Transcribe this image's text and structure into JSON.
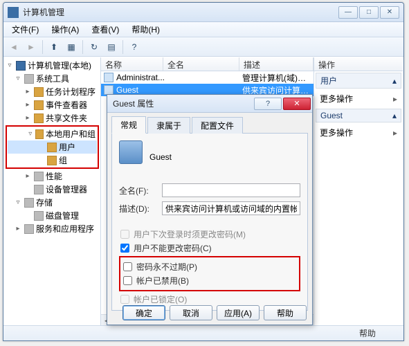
{
  "window": {
    "title": "计算机管理",
    "minimize": "—",
    "maximize": "□",
    "close": "✕"
  },
  "menu": {
    "file": "文件(F)",
    "action": "操作(A)",
    "view": "查看(V)",
    "help": "帮助(H)"
  },
  "tree": {
    "root": "计算机管理(本地)",
    "system_tools": "系统工具",
    "task_scheduler": "任务计划程序",
    "event_viewer": "事件查看器",
    "shared_folders": "共享文件夹",
    "local_users_groups": "本地用户和组",
    "users": "用户",
    "groups": "组",
    "performance": "性能",
    "device_manager": "设备管理器",
    "storage": "存储",
    "disk_management": "磁盘管理",
    "services_apps": "服务和应用程序"
  },
  "list": {
    "columns": {
      "name": "名称",
      "fullname": "全名",
      "description": "描述"
    },
    "rows": [
      {
        "name": "Administrat...",
        "fullname": "",
        "description": "管理计算机(域)的内置帐户"
      },
      {
        "name": "Guest",
        "fullname": "",
        "description": "供来宾访问计算机或访问域的内"
      }
    ]
  },
  "actions": {
    "title": "操作",
    "group1": "用户",
    "more1": "更多操作",
    "group2": "Guest",
    "more2": "更多操作",
    "chevron": "▸",
    "collapse": "▴"
  },
  "statusbar": {
    "help": "帮助"
  },
  "dialog": {
    "title": "Guest 属性",
    "help_btn": "?",
    "close_btn": "✕",
    "tabs": {
      "general": "常规",
      "member_of": "隶属于",
      "profile": "配置文件"
    },
    "username": "Guest",
    "fullname_label": "全名(F):",
    "fullname_value": "",
    "description_label": "描述(D):",
    "description_value": "供来宾访问计算机或访问域的内置帐户",
    "checks": {
      "must_change": "用户下次登录时须更改密码(M)",
      "cannot_change": "用户不能更改密码(C)",
      "never_expire": "密码永不过期(P)",
      "disabled": "帐户已禁用(B)",
      "locked": "帐户已锁定(O)"
    },
    "buttons": {
      "ok": "确定",
      "cancel": "取消",
      "apply": "应用(A)",
      "help": "帮助"
    }
  }
}
